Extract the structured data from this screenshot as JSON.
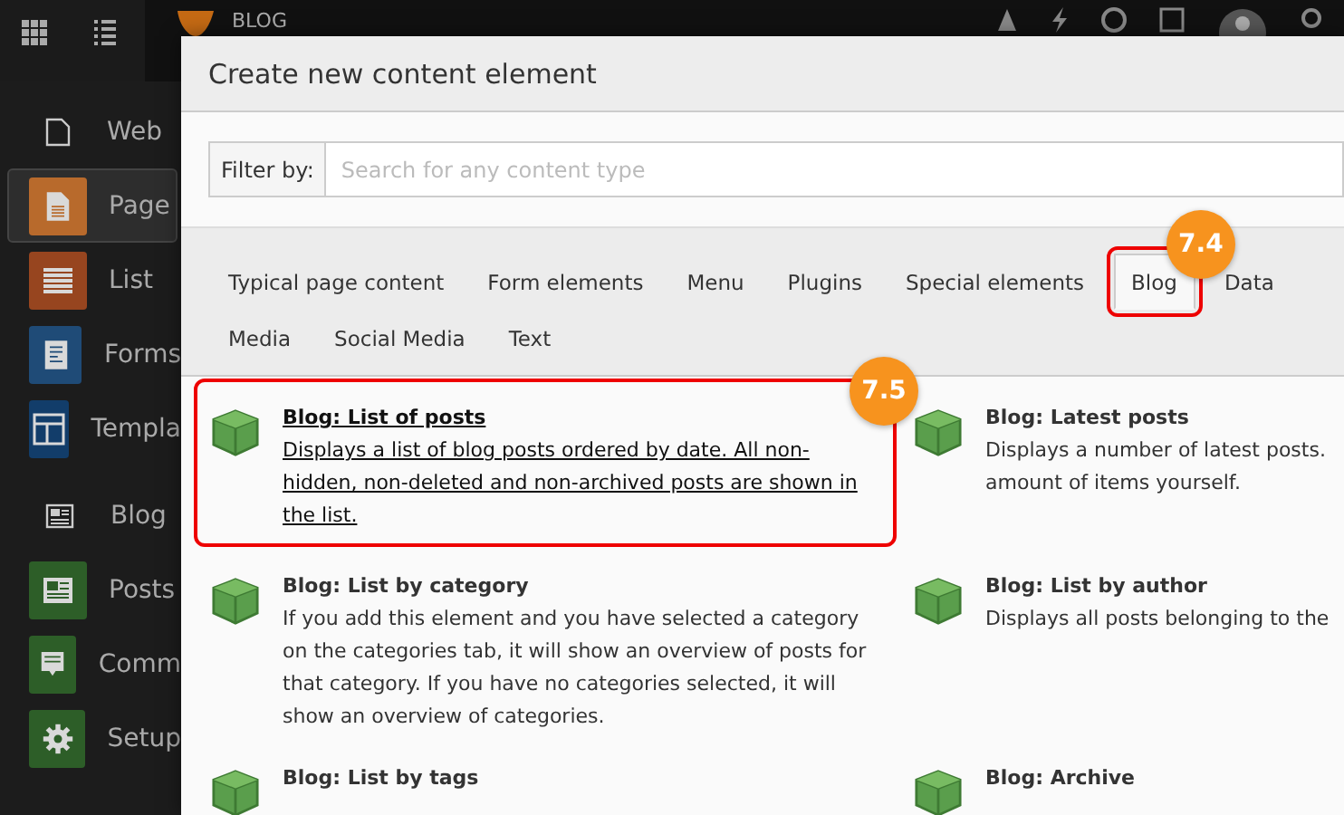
{
  "top_bar": {
    "site_name": "BLOG"
  },
  "sidebar": {
    "items": [
      {
        "kind": "group",
        "label": "Web"
      },
      {
        "kind": "module",
        "label": "Page",
        "color": "#b86a2c",
        "selected": true
      },
      {
        "kind": "module",
        "label": "List",
        "color": "#97451f",
        "selected": false
      },
      {
        "kind": "module",
        "label": "Forms",
        "color": "#1f4b77",
        "selected": false
      },
      {
        "kind": "module",
        "label": "Templa",
        "color": "#123d6a",
        "selected": false
      },
      {
        "kind": "group",
        "label": "Blog"
      },
      {
        "kind": "module",
        "label": "Posts",
        "color": "#2d5e28",
        "selected": false
      },
      {
        "kind": "module",
        "label": "Comm",
        "color": "#2d5e28",
        "selected": false
      },
      {
        "kind": "module",
        "label": "Setup",
        "color": "#2d5e28",
        "selected": false
      }
    ]
  },
  "modal": {
    "title": "Create new content element",
    "filter": {
      "label": "Filter by:",
      "placeholder": "Search for any content type"
    },
    "tabs": [
      {
        "label": "Typical page content",
        "selected": false,
        "highlighted": false
      },
      {
        "label": "Form elements",
        "selected": false,
        "highlighted": false
      },
      {
        "label": "Menu",
        "selected": false,
        "highlighted": false
      },
      {
        "label": "Plugins",
        "selected": false,
        "highlighted": false
      },
      {
        "label": "Special elements",
        "selected": false,
        "highlighted": false
      },
      {
        "label": "Blog",
        "selected": true,
        "highlighted": true,
        "callout": "7.4"
      },
      {
        "label": "Data",
        "selected": false,
        "highlighted": false
      },
      {
        "label": "Media",
        "selected": false,
        "highlighted": false
      },
      {
        "label": "Social Media",
        "selected": false,
        "highlighted": false
      },
      {
        "label": "Text",
        "selected": false,
        "highlighted": false
      }
    ],
    "elements": [
      {
        "title": "Blog: List of posts",
        "description": "Displays a list of blog posts ordered by date. All non-hidden, non-deleted and non-archived posts are shown in the list.",
        "highlighted": true,
        "callout": "7.5"
      },
      {
        "title": "Blog: Latest posts",
        "description": "Displays a number of latest posts.\namount of items yourself.",
        "highlighted": false
      },
      {
        "title": "Blog: List by category",
        "description": "If you add this element and you have selected a category on the categories tab, it will show an overview of posts for that category. If you have no categories selected, it will show an overview of categories.",
        "highlighted": false
      },
      {
        "title": "Blog: List by author",
        "description": "Displays all posts belonging to the",
        "highlighted": false
      },
      {
        "title": "Blog: List by tags",
        "highlighted": false
      },
      {
        "title": "Blog: Archive",
        "highlighted": false
      }
    ]
  }
}
